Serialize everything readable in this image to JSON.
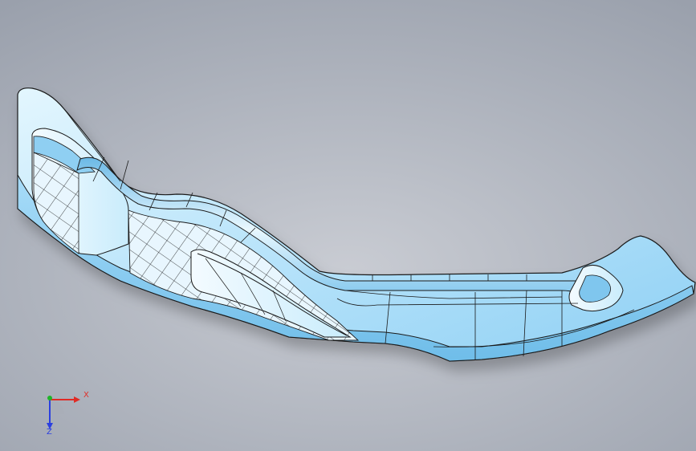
{
  "triad": {
    "x_label": "X",
    "z_label": "Z",
    "colors": {
      "x": "#e02b25",
      "y": "#1fb52a",
      "z": "#2b3fe0"
    },
    "icon": "coordinate-triad-icon"
  },
  "model": {
    "icon": "cad-part-icon",
    "colors": {
      "face_light": "#d4f1fd",
      "face_mid": "#9fd8f7",
      "edge": "#1a1a1a"
    }
  }
}
